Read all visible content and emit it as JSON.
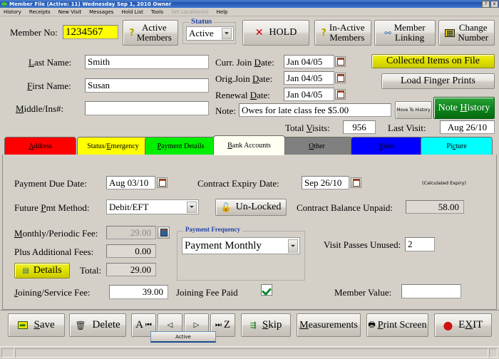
{
  "window": {
    "title": "Member File (Active: 11)     Wednesday  Sep 1, 2010 Owner",
    "help_button": "?",
    "close_button": "x",
    "icon": "plus-green-icon"
  },
  "menubar": {
    "items": [
      {
        "label": "History",
        "enabled": true
      },
      {
        "label": "Receipts",
        "enabled": true
      },
      {
        "label": "New Visit",
        "enabled": true
      },
      {
        "label": "Messages",
        "enabled": true
      },
      {
        "label": "Hold List",
        "enabled": true
      },
      {
        "label": "Tools",
        "enabled": true
      },
      {
        "label": "Set Location(s)",
        "enabled": false
      },
      {
        "label": "Help",
        "enabled": true
      }
    ]
  },
  "header": {
    "member_no_label": "Member No:",
    "member_no_value": "1234567",
    "member_no_bg": "#ffff00",
    "active_members_button": "Active Members",
    "active_members_icon": "question-mark-icon",
    "status_group_caption": "Status",
    "status_value": "Active",
    "hold_button": "HOLD",
    "hold_icon": "red-x-icon",
    "inactive_members_button": "In-Active Members",
    "inactive_members_icon": "question-mark-icon",
    "member_linking_button": "Member Linking",
    "member_linking_icon": "org-chart-icon",
    "change_number_button": "Change Number",
    "change_number_icon": "grid-keypad-icon"
  },
  "details": {
    "last_name_label": "Last Name:",
    "last_name_value": "Smith",
    "first_name_label": "First Name:",
    "first_name_value": "Susan",
    "middle_label": "Middle/Ins#:",
    "middle_value": "",
    "curr_join_label": "Curr. Join Date:",
    "curr_join_value": "Jan 04/05",
    "orig_join_label": "Orig.Join Date:",
    "orig_join_value": "Jan 04/05",
    "renewal_label": "Renewal Date:",
    "renewal_value": "Jan 04/05",
    "note_label": "Note:",
    "note_value": "Owes for late class fee $5.00",
    "move_to_history_button": "Move To History",
    "note_history_button": "Note History",
    "note_history_color": "#0a7a12",
    "total_visits_label": "Total Visits:",
    "total_visits_value": "956",
    "last_visit_label": "Last Visit:",
    "last_visit_value": "Aug 26/10",
    "collected_items_button": "Collected Items on File",
    "collected_items_color": "#d9d900",
    "load_finger_prints_button": "Load Finger Prints",
    "calendar_icon": "calendar-icon"
  },
  "tabs": [
    {
      "label": "Address",
      "color": "#ff0000",
      "selected": false
    },
    {
      "label": "Status/Emergency",
      "color": "#ffff00",
      "selected": false
    },
    {
      "label": "Payment Details",
      "color": "#00e000",
      "selected": false
    },
    {
      "label": "Bank Accounts",
      "color": "#fffff4",
      "selected": true
    },
    {
      "label": "Other",
      "color": "#808080",
      "selected": false
    },
    {
      "label": "Visits",
      "color": "#0000ff",
      "selected": false
    },
    {
      "label": "Picture",
      "color": "#00ffff",
      "selected": false
    }
  ],
  "payment": {
    "payment_due_label": "Payment Due Date:",
    "payment_due_value": "Aug 03/10",
    "contract_expiry_label": "Contract Expiry Date:",
    "contract_expiry_value": "Sep 26/10",
    "calculated_expiry_note": "(Calculated Expiry)",
    "future_pmt_label": "Future Pmt Method:",
    "future_pmt_value": "Debit/EFT",
    "unlocked_button": "Un-Locked",
    "unlocked_icon": "padlock-open-icon",
    "contract_balance_label": "Contract Balance Unpaid:",
    "contract_balance_value": "58.00",
    "monthly_fee_label": "Monthly/Periodic Fee:",
    "monthly_fee_value": "29.00",
    "monthly_fee_icon": "save-disk-icon",
    "payment_frequency_caption": "Payment Frequency",
    "payment_frequency_value": "Payment Monthly",
    "visit_passes_label": "Visit Passes Unused:",
    "visit_passes_value": "2",
    "plus_additional_label": "Plus Additional Fees:",
    "plus_additional_value": "0.00",
    "details_button": "Details",
    "details_icon": "document-icon",
    "details_color": "#d9d900",
    "total_label": "Total:",
    "total_value": "29.00",
    "joining_fee_label": "Joining/Service Fee:",
    "joining_fee_value": "39.00",
    "joining_fee_paid_label": "Joining Fee Paid",
    "joining_fee_paid_checked": true,
    "member_value_label": "Member Value:",
    "member_value_value": ""
  },
  "toolbar": {
    "save_button": "Save",
    "save_icon": "save-icon",
    "delete_button": "Delete",
    "delete_icon": "trash-icon",
    "nav_first_label": "A",
    "nav_first_icon": "first-record-icon",
    "nav_prev_icon": "previous-record-icon",
    "nav_next_icon": "next-record-icon",
    "nav_last_label": "Z",
    "nav_last_icon": "last-record-icon",
    "skip_button": "Skip",
    "skip_icon": "person-skip-icon",
    "measurements_button": "Measurements",
    "print_screen_button": "Print Screen",
    "print_screen_icon": "printer-icon",
    "exit_button": "EXIT",
    "exit_icon": "red-circle-icon",
    "active_tab_label": "Active"
  }
}
